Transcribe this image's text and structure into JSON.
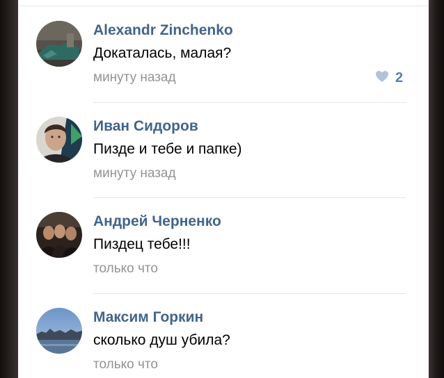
{
  "comments": [
    {
      "author": "Alexandr Zinchenko",
      "text": "Докаталась, малая?",
      "time": "минуту назад",
      "likes": "2",
      "like_icon": "heart-icon"
    },
    {
      "author": "Иван Сидоров",
      "text": "Пизде и тебе и папке)",
      "time": "минуту назад"
    },
    {
      "author": "Андрей Черненко",
      "text": "Пиздец тебе!!!",
      "time": "только что"
    },
    {
      "author": "Максим Горкин",
      "text": "сколько душ убила?",
      "time": "только что"
    }
  ],
  "colors": {
    "author": "#42648b",
    "time": "#939393",
    "like_heart": "#b1c3d9",
    "like_count": "#5181b8",
    "divider": "#e3e6ea"
  }
}
